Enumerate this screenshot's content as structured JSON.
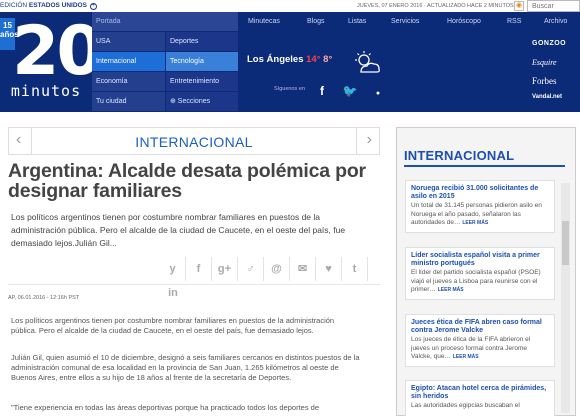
{
  "topbar": {
    "edition_prefix": "EDICIÓN",
    "edition_name": "ESTADOS UNIDOS",
    "edition_icon": "plus-circle-icon",
    "date": "JUEVES, 07 ENERO 2016 · ACTUALIZADO HACE 2 MINUTOS",
    "rss_icon": "rss-icon",
    "search_placeholder": "Buscar"
  },
  "logo": {
    "badge": "15 años",
    "big": "20",
    "word": "minutos"
  },
  "section_nav": {
    "portada": "Portada",
    "left": [
      "USA",
      "Internacional",
      "Economía",
      "Tu ciudad"
    ],
    "right": [
      "Deportes",
      "Tecnología",
      "Entretenimiento",
      "⊕ Secciones"
    ]
  },
  "top_menu": [
    "Minutecas",
    "Blogs",
    "Listas",
    "Servicios",
    "Horóscopo",
    "RSS",
    "Archivo"
  ],
  "weather": {
    "city": "Los Ángeles",
    "high": "14°",
    "low": "8°",
    "icon": "partly-cloudy-icon"
  },
  "follow": {
    "label": "Síguenos en",
    "icons": [
      "facebook-icon",
      "twitter-icon",
      "dot-icon"
    ],
    "glyphs": [
      "f",
      "🐦",
      "●"
    ]
  },
  "partners": [
    "GONZOO",
    "Esquire",
    "Forbes",
    "Vandal.net"
  ],
  "section_header": {
    "title": "INTERNACIONAL",
    "prev": "‹",
    "next": "›"
  },
  "article": {
    "headline": "Argentina: Alcalde desata polémica por designar familiares",
    "lead": "Los políticos argentinos tienen por costumbre nombrar familiares en puestos de la administración pública. Pero el alcalde de la ciudad de Caucete, en el oeste del país, fue demasiado lejos.Julián Gil...",
    "share": [
      "y",
      "f",
      "g+",
      "♂",
      "@",
      "✉",
      "♥",
      "t",
      "in"
    ],
    "byline": "AP, 06.01.2016 - 12:16h PST",
    "paragraphs": [
      "Los políticos argentinos tienen por costumbre nombrar familiares en puestos de la administración pública. Pero el alcalde de la ciudad de Caucete, en el oeste del país, fue demasiado lejos.",
      "Julián Gil, quien asumió el 10 de diciembre, designó a seis familiares cercanos en distintos puestos de la administración comunal de esa localidad en la provincia de San Juan, 1.265 kilómetros al oeste de Buenos Aires, entre ellos a su hijo de 18 años al frente de la secretaría de Deportes.",
      "\"Tiene experiencia en todas las áreas deportivas porque ha practicado todos los deportes de"
    ]
  },
  "sidebar": {
    "title": "INTERNACIONAL",
    "more_label": "LEER MÁS",
    "cards": [
      {
        "title": "Noruega recibió 31.000 solicitantes de asilo en 2015",
        "desc": "Un total de 31.145 personas pidieron asilo en Noruega el año pasado, señalaron las autoridades de…"
      },
      {
        "title": "Líder socialista español visita a primer ministro portugués",
        "desc": "El líder del partido socialista español (PSOE) viajó el jueves a Lisboa para reunirse con el primer…"
      },
      {
        "title": "Jueces ética de FIFA abren caso formal contra Jerome Valcke",
        "desc": "Los jueces de ética de la FIFA abrieron el jueves un proceso formal contra Jerome Valcke, que…"
      },
      {
        "title": "Egipto: Atacan hotel cerca de pirámides, sin heridos",
        "desc": "Las autoridades egipcias buscaban el"
      }
    ]
  }
}
